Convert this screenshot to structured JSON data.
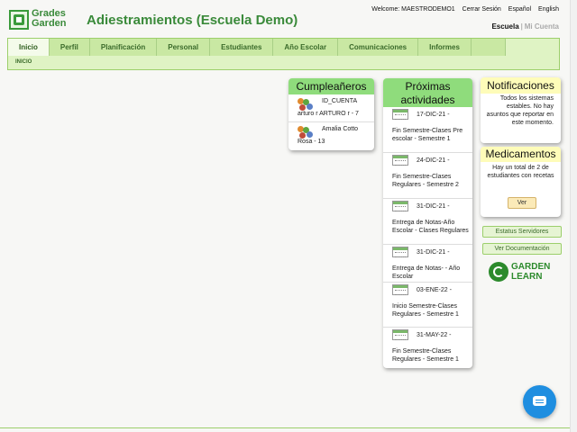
{
  "header": {
    "logo_text_line1": "Grades",
    "logo_text_line2": "Garden",
    "title": "Adiestramientos (Escuela Demo)",
    "welcome": "Welcome: MAESTRODEMO1",
    "logout": "Cerrar Sesión",
    "lang_es": "Español",
    "lang_en": "English",
    "school": "Escuela",
    "separator": "|",
    "my_account": "Mi Cuenta"
  },
  "nav": {
    "tabs": [
      "Inicio",
      "Perfil",
      "Planificación",
      "Personal",
      "Estudiantes",
      "Año Escolar",
      "Comunicaciones",
      "Informes",
      ""
    ],
    "active_index": 0,
    "breadcrumb": "INICIO"
  },
  "birthdays": {
    "title": "Cumpleañeros",
    "items": [
      {
        "name": "ID_CUENTA",
        "detail": "arturo r ARTURO r - 7"
      },
      {
        "name": "Amalia Cotto",
        "detail": "Rosa - 13"
      }
    ]
  },
  "activities": {
    "title_line1": "Próximas",
    "title_line2": "actividades",
    "items": [
      {
        "date": "17-DIC-21 -",
        "desc": "Fin Semestre-Clases Pre escolar - Semestre 1"
      },
      {
        "date": "24-DIC-21 -",
        "desc": "Fin Semestre-Clases Regulares - Semestre 2"
      },
      {
        "date": "31-DIC-21 -",
        "desc": "Entrega de Notas-Año Escolar - Clases Regulares"
      },
      {
        "date": "31-DIC-21 -",
        "desc": "Entrega de Notas- - Año Escolar"
      },
      {
        "date": "03-ENE-22 -",
        "desc": "Inicio Semestre-Clases Regulares - Semestre 1"
      },
      {
        "date": "31-MAY-22 -",
        "desc": "Fin Semestre-Clases Regulares - Semestre 1"
      }
    ]
  },
  "notifications": {
    "title": "Notificaciones",
    "body": "Todos los sistemas estables. No hay asuntos que reportar en este momento."
  },
  "medications": {
    "title": "Medicamentos",
    "body": "Hay un total de 2 de estudiantes con recetas",
    "button": "Ver"
  },
  "side_buttons": {
    "server_status": "Estatus Servidores",
    "documentation": "Ver Documentación"
  },
  "garden_learn": {
    "line1": "GARDEN",
    "line2": "LEARN"
  },
  "icons": {
    "chat": "chat-bubble-icon",
    "birthday": "people-icon",
    "activity": "calendar-icon"
  },
  "colors": {
    "brand_green": "#3a8a3a",
    "header_green": "#8fdc7c",
    "nav_bg": "#dff3c4",
    "notif_yellow": "#fefcb9",
    "chat_blue": "#1f8ee0"
  }
}
